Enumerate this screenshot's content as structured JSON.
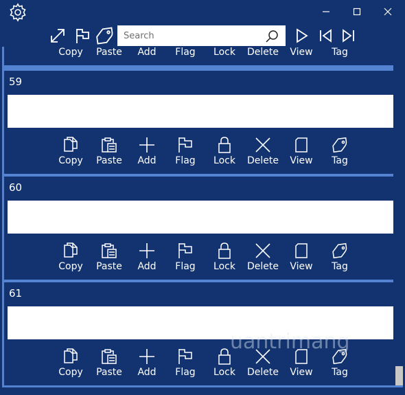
{
  "toolbar": {
    "search_placeholder": "Search"
  },
  "actions": [
    "Copy",
    "Paste",
    "Add",
    "Flag",
    "Lock",
    "Delete",
    "View",
    "Tag"
  ],
  "notes": [
    {
      "number": "59"
    },
    {
      "number": "60"
    },
    {
      "number": "61"
    }
  ],
  "watermark": "uantrimang",
  "colors": {
    "background": "#12336f",
    "separator": "#5282d0",
    "field": "#ffffff"
  }
}
